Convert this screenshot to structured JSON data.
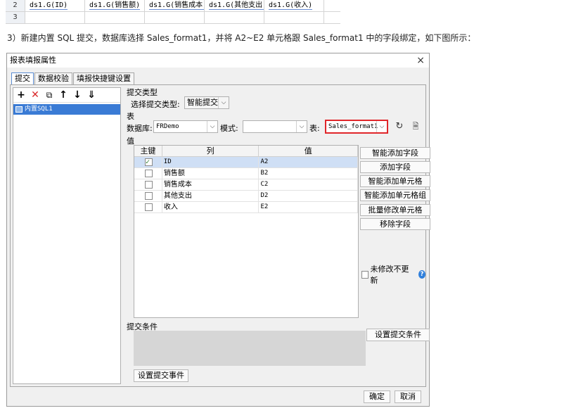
{
  "sheet": {
    "rows": [
      {
        "num": "2",
        "cells": [
          "ds1.G(ID)",
          "ds1.G(销售额)",
          "ds1.G(销售成本)",
          "ds1.G(其他支出)",
          "ds1.G(收入)"
        ]
      },
      {
        "num": "3",
        "cells": [
          "",
          "",
          "",
          "",
          ""
        ]
      }
    ]
  },
  "caption": "3）新建内置 SQL 提交，数据库选择 Sales_format1，并将 A2~E2 单元格跟 Sales_format1 中的字段绑定，如下图所示：",
  "dialog": {
    "title": "报表填报属性",
    "close": "×",
    "tabs": [
      "提交",
      "数据校验",
      "填报快捷键设置"
    ],
    "toolbar": [
      "+",
      "✕",
      "⧉",
      "↑",
      "↓",
      "⇓"
    ],
    "tree_item": "内置SQL1",
    "submit_type_section": "提交类型",
    "submit_type_label": "选择提交类型:",
    "submit_type_value": "智能提交",
    "table_section": "表",
    "db_label": "数据库:",
    "db_value": "FRDemo",
    "mode_label": "模式:",
    "mode_value": "",
    "table_label": "表:",
    "table_value": "Sales_format1",
    "refresh_icon": "↻",
    "preview_icon": "🗎",
    "value_section": "值",
    "grid_headers": [
      "主键",
      "列",
      "值"
    ],
    "grid_rows": [
      {
        "key": true,
        "col": "ID",
        "val": "A2"
      },
      {
        "key": false,
        "col": "销售额",
        "val": "B2"
      },
      {
        "key": false,
        "col": "销售成本",
        "val": "C2"
      },
      {
        "key": false,
        "col": "其他支出",
        "val": "D2"
      },
      {
        "key": false,
        "col": "收入",
        "val": "E2"
      }
    ],
    "side_buttons": [
      "智能添加字段",
      "添加字段",
      "智能添加单元格",
      "智能添加单元格组",
      "批量修改单元格",
      "移除字段"
    ],
    "unmodified_label": "未修改不更新",
    "help": "?",
    "condition_section": "提交条件",
    "set_condition": "设置提交条件",
    "set_event": "设置提交事件",
    "ok": "确定",
    "cancel": "取消"
  }
}
